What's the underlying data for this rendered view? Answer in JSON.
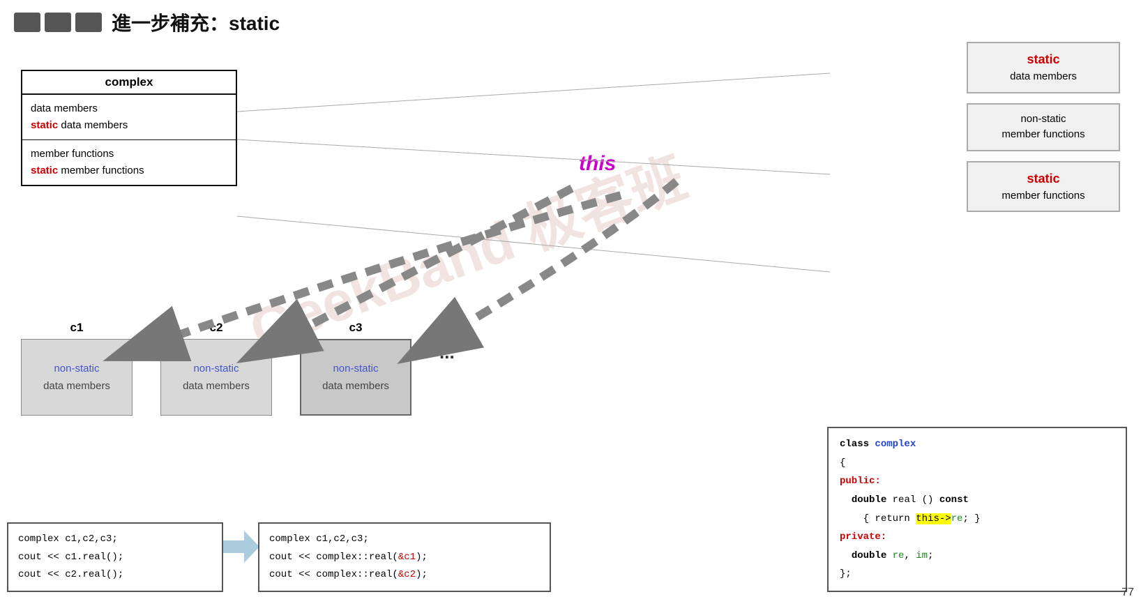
{
  "header": {
    "title": "進一步補充：static",
    "icon_count": 3
  },
  "class_diagram": {
    "title": "complex",
    "section1_line1": "data members",
    "section1_line2_prefix": "",
    "section1_line2_static": "static",
    "section1_line2_suffix": " data members",
    "section2_line1": "member functions",
    "section2_line2_prefix": "",
    "section2_line2_static": "static",
    "section2_line2_suffix": " member functions"
  },
  "right_boxes": [
    {
      "id": "rb1",
      "label_static": "static",
      "label_rest": "data members"
    },
    {
      "id": "rb2",
      "label_main": "non-static\nmember functions"
    },
    {
      "id": "rb3",
      "label_static": "static",
      "label_rest": "member functions"
    }
  ],
  "instances": [
    {
      "id": "c1",
      "label": "c1",
      "line1": "non-static",
      "line2": "data members"
    },
    {
      "id": "c2",
      "label": "c2",
      "line1": "non-static",
      "line2": "data members"
    },
    {
      "id": "c3",
      "label": "c3",
      "line1": "non-static",
      "line2": "data members"
    }
  ],
  "this_label_top": "this",
  "this_label_bottom": "this",
  "code_left": {
    "line1": "complex c1,c2,c3;",
    "line2": "cout << c1.real();",
    "line3": "cout << c2.real();"
  },
  "code_middle": {
    "line1": "complex c1,c2,c3;",
    "line2_prefix": "cout << complex::real(",
    "line2_amp": "&c1",
    "line2_suffix": ");",
    "line3_prefix": "cout << complex::real(",
    "line3_amp": "&c2",
    "line3_suffix": ");"
  },
  "code_right": {
    "line1": "class complex",
    "line2": "{",
    "line3": "public:",
    "line4": "  double real () const",
    "line5_prefix": "    { return ",
    "line5_highlight": "this->",
    "line5_suffix": "re; }",
    "line6": "private:",
    "line7": "  double re, im;",
    "line8": "};"
  },
  "page_number": "77",
  "watermark": "GeekBand 极客班"
}
